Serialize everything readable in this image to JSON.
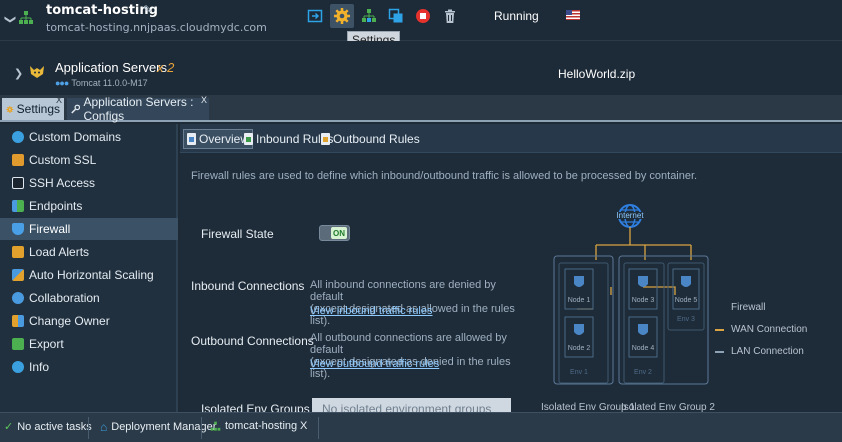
{
  "env": {
    "name": "tomcat-hosting",
    "domain": "tomcat-hosting.nnjpaas.cloudmydc.com",
    "status": "Running",
    "tooltip": "Settings"
  },
  "app_server": {
    "title": "Application Servers",
    "count": "x 2",
    "version": "Tomcat 11.0.0-M17",
    "deployment": "HelloWorld.zip"
  },
  "tabs": [
    {
      "label": "Settings"
    },
    {
      "label": "Application Servers : Configs"
    }
  ],
  "sidebar": {
    "items": [
      {
        "label": "Custom Domains",
        "icon": "globe-icon",
        "color": "#3aa0e0"
      },
      {
        "label": "Custom SSL",
        "icon": "certificate-icon",
        "color": "#e09a2e"
      },
      {
        "label": "SSH Access",
        "icon": "terminal-icon",
        "color": "#dfe6ed"
      },
      {
        "label": "Endpoints",
        "icon": "endpoints-icon",
        "color": "#4a9ae0"
      },
      {
        "label": "Firewall",
        "icon": "shield-icon",
        "color": "#4aa0e6"
      },
      {
        "label": "Load Alerts",
        "icon": "alert-icon",
        "color": "#e2a02c"
      },
      {
        "label": "Auto Horizontal Scaling",
        "icon": "scaling-icon",
        "color": "#4a9ae0"
      },
      {
        "label": "Collaboration",
        "icon": "collaboration-icon",
        "color": "#4a9ae0"
      },
      {
        "label": "Change Owner",
        "icon": "change-owner-icon",
        "color": "#e2a02c"
      },
      {
        "label": "Export",
        "icon": "export-icon",
        "color": "#4caf50"
      },
      {
        "label": "Info",
        "icon": "info-icon",
        "color": "#3aa0e0"
      }
    ],
    "selected": "Firewall"
  },
  "subtabs": [
    {
      "label": "Overview"
    },
    {
      "label": "Inbound Rules"
    },
    {
      "label": "Outbound Rules"
    }
  ],
  "firewall": {
    "description": "Firewall rules are used to define which inbound/outbound traffic is allowed to be processed by container.",
    "state_label": "Firewall State",
    "state_value": "ON",
    "inbound_label": "Inbound Connections",
    "inbound_text_1": "All inbound connections are denied by default",
    "inbound_text_2": "(except designated as allowed in the rules list).",
    "inbound_link": "View inbound traffic rules",
    "outbound_label": "Outbound Connections",
    "outbound_text_1": "All outbound connections are allowed by default",
    "outbound_text_2": "(except designated as denied in the rules list).",
    "outbound_link": "View outbound traffic rules",
    "isolated_label": "Isolated Env Groups",
    "isolated_value": "No isolated environment groups"
  },
  "diagram": {
    "internet": "Internet",
    "nodes": [
      "Node 1",
      "Node 2",
      "Node 3",
      "Node 4",
      "Node 5"
    ],
    "envs": [
      "Env 1",
      "Env 2",
      "Env 3"
    ],
    "groups": [
      "Isolated Env Group 1",
      "Isolated Env Group 2"
    ],
    "legend_title": "Firewall",
    "legend_wan": "WAN Connection",
    "legend_lan": "LAN Connection",
    "colors": {
      "wan": "#d9a441",
      "lan": "#8ea2b6"
    }
  },
  "taskbar": {
    "tasks_label": "No active tasks",
    "deployment_manager": "Deployment Manager",
    "env_tab": "tomcat-hosting",
    "close": "X"
  }
}
